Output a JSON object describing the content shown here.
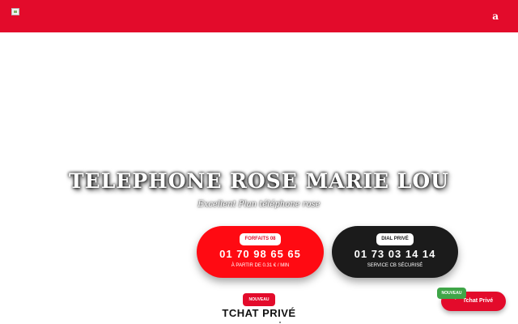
{
  "header": {
    "menu_glyph": "a",
    "logo_icon": "broken-image-icon",
    "background_color": "#e30b2b"
  },
  "hero": {
    "title": "TELEPHONE ROSE MARIE LOU",
    "subtitle": "Excellent Plan téléphone rose"
  },
  "calls": [
    {
      "badge": "FORFAITS 08",
      "number": "01 70 98 65 65",
      "sub": "À PARTIR DE 0.31 € / MIN",
      "color": "#ff0a12"
    },
    {
      "badge": "DIAL PRIVÉ",
      "number": "01 73 03 14 14",
      "sub": "SERVICE CB SÉCURISÉ",
      "color": "#1b1b1b"
    }
  ],
  "tchat": {
    "badge": "NOUVEAU",
    "title": "TCHAT PRIVÉ"
  },
  "floating": {
    "badge": "NOUVEAU",
    "label": "Tchat Privé",
    "icon": "chat-bubble-icon",
    "badge_color": "#3fa548"
  }
}
